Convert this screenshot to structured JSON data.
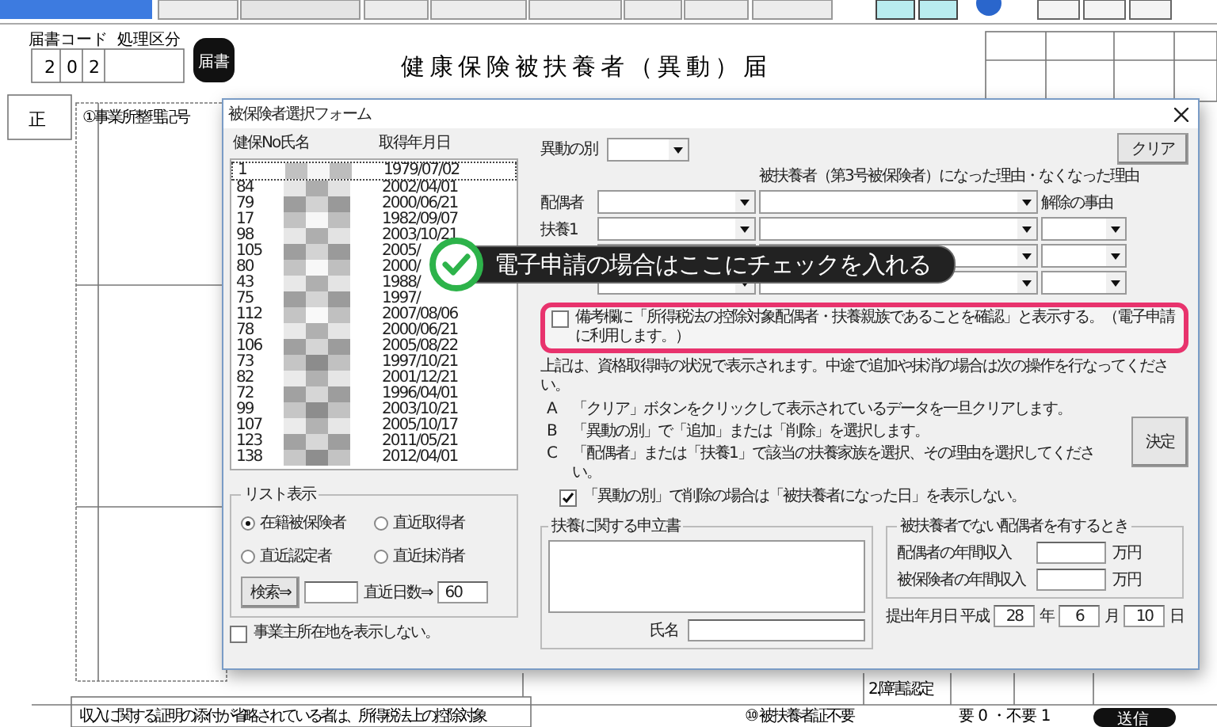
{
  "form": {
    "title": "健康保険被扶養者（異動）届",
    "code_label": "届書コード",
    "category_label": "処理区分",
    "code_digits": [
      "2",
      "0",
      "2"
    ],
    "badge": "届書",
    "copy_mark": "正",
    "office_code_label": "①事業所整理記号",
    "disability_label": "2.障害認定",
    "card_label": "⑩ 被扶養者証不要",
    "card_option": "要 0 ・不要 1",
    "send_label": "送信",
    "note": "収入に関する証明の添付が省略されている者は、所得税法上の控除対象"
  },
  "dialog": {
    "title": "被保険者選択フォーム",
    "list": {
      "columns": [
        "健保No",
        "氏名",
        "取得年月日"
      ],
      "rows": [
        {
          "no": "1",
          "date": "1979/07/02",
          "focused": true
        },
        {
          "no": "84",
          "date": "2002/04/01",
          "focused": false
        },
        {
          "no": "79",
          "date": "2000/06/21",
          "focused": false
        },
        {
          "no": "17",
          "date": "1982/09/07",
          "focused": false
        },
        {
          "no": "98",
          "date": "2003/10/21",
          "focused": false
        },
        {
          "no": "105",
          "date": "2005/",
          "focused": false
        },
        {
          "no": "80",
          "date": "2000/",
          "focused": false
        },
        {
          "no": "43",
          "date": "1988/",
          "focused": false
        },
        {
          "no": "75",
          "date": "1997/",
          "focused": false
        },
        {
          "no": "112",
          "date": "2007/08/06",
          "focused": false
        },
        {
          "no": "78",
          "date": "2000/06/21",
          "focused": false
        },
        {
          "no": "106",
          "date": "2005/08/22",
          "focused": false
        },
        {
          "no": "73",
          "date": "1997/10/21",
          "focused": false
        },
        {
          "no": "82",
          "date": "2001/12/21",
          "focused": false
        },
        {
          "no": "72",
          "date": "1996/04/01",
          "focused": false
        },
        {
          "no": "99",
          "date": "2003/10/21",
          "focused": false
        },
        {
          "no": "107",
          "date": "2005/10/17",
          "focused": false
        },
        {
          "no": "123",
          "date": "2011/05/21",
          "focused": false
        },
        {
          "no": "138",
          "date": "2012/04/01",
          "focused": false
        }
      ]
    },
    "list_filter": {
      "title": "リスト表示",
      "options": [
        {
          "label": "在籍被保険者",
          "selected": true
        },
        {
          "label": "直近取得者",
          "selected": false
        },
        {
          "label": "直近認定者",
          "selected": false
        },
        {
          "label": "直近抹消者",
          "selected": false
        }
      ],
      "search_button": "検索⇒",
      "days_label": "直近日数⇒",
      "days_value": "60"
    },
    "hide_address": {
      "label": "事業主所在地を表示しない。",
      "checked": false
    },
    "change_type_label": "異動の別",
    "clear_button": "クリア",
    "reason_header": "被扶養者（第3号被保険者）になった理由・なくなった理由",
    "release_header": "解除の事由",
    "members": [
      {
        "label": "配偶者",
        "kind": "spouse"
      },
      {
        "label": "扶養1",
        "kind": "dependent"
      },
      {
        "kind": "dependent"
      },
      {
        "kind": "dependent"
      }
    ],
    "remarks_option": {
      "label": "備考欄に「所得税法の控除対象配偶者・扶養親族であることを確認」と表示する。（電子申請に利用します。）",
      "checked": false,
      "highlighted": true
    },
    "callout": "電子申請の場合はここにチェックを入れる",
    "intro": "上記は、資格取得時の状況で表示されます。中途で追加や抹消の場合は次の操作を行なってください。",
    "steps": [
      {
        "mark": "A",
        "text": "「クリア」ボタンをクリックして表示されているデータを一旦クリアします。"
      },
      {
        "mark": "B",
        "text": "「異動の別」で「追加」または「削除」を選択します。"
      },
      {
        "mark": "C",
        "text": "「配偶者」または「扶養1」で該当の扶養家族を選択、その理由を選択してください。"
      }
    ],
    "confirm_button": "決定",
    "hide_date_option": {
      "label": "「異動の別」で削除の場合は「被扶養者になった日」を表示しない。",
      "checked": true
    },
    "statement": {
      "title": "扶養に関する申立書",
      "name_label": "氏名"
    },
    "income": {
      "title": "被扶養者でない配偶者を有するとき",
      "rows": [
        {
          "label": "配偶者の年間収入",
          "unit": "万円"
        },
        {
          "label": "被保険者の年間収入",
          "unit": "万円"
        }
      ]
    },
    "submission": [
      {
        "kind": "label",
        "text": "提出年月日 平成"
      },
      {
        "kind": "field",
        "value": "28"
      },
      {
        "kind": "label",
        "text": "年"
      },
      {
        "kind": "field",
        "value": "6"
      },
      {
        "kind": "label",
        "text": "月"
      },
      {
        "kind": "field",
        "value": "10"
      },
      {
        "kind": "label",
        "text": "日"
      }
    ]
  }
}
